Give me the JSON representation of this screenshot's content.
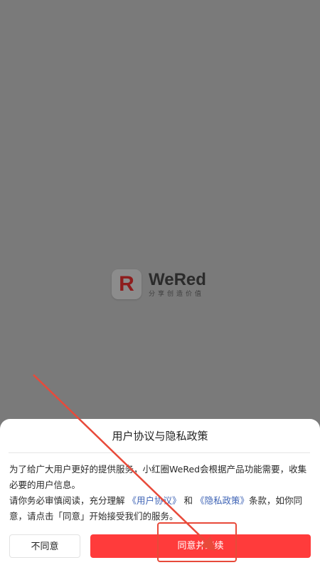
{
  "splash": {
    "logo_letter": "R",
    "app_name": "WeRed",
    "tagline": "分享创造价值"
  },
  "dialog": {
    "title": "用户协议与隐私政策",
    "paragraph1": "为了给广大用户更好的提供服务，小红圈WeRed会根据产品功能需要，收集必要的用户信息。",
    "paragraph2_prefix": "请你务必审慎阅读，充分理解",
    "user_agreement_link": "《用户协议》",
    "conjunction": "和",
    "privacy_policy_link": "《隐私政策》",
    "paragraph2_suffix": "条款，如你同意，请点击「同意」开始接受我们的服务。",
    "disagree_label": "不同意",
    "agree_label": "同意并继续"
  },
  "colors": {
    "overlay": "#7a7a7a",
    "accent_red": "#ff3b3b",
    "link_blue": "#3e63b5",
    "annotation_red": "#e84a3a"
  }
}
